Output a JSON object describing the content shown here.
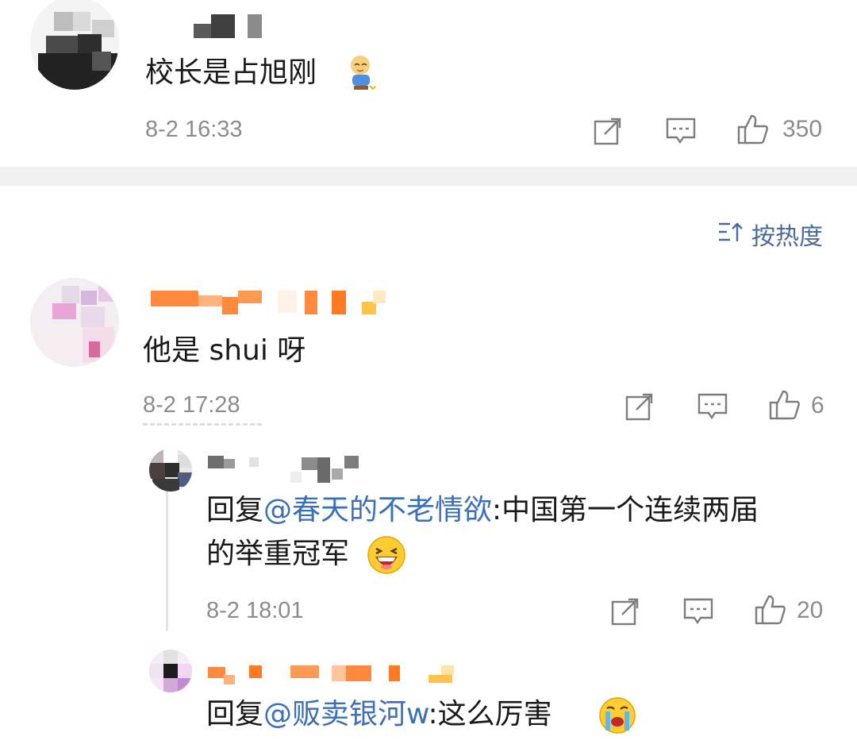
{
  "comments": [
    {
      "text": "校长是占旭刚",
      "time": "8-2 16:33",
      "likes": "350"
    },
    {
      "text": "他是 shui 呀",
      "time": "8-2 17:28",
      "likes": "6",
      "replies": [
        {
          "prefix": "回复",
          "mention": "@春天的不老情欲",
          "text_line1": ":中国第一个连续两届",
          "text_line2": "的举重冠军",
          "time": "8-2 18:01",
          "likes": "20"
        },
        {
          "prefix": "回复",
          "mention": "@贩卖银河w",
          "text_line1": ":这么厉害"
        }
      ]
    }
  ],
  "sort_label": "按热度",
  "colors": {
    "mention": "#3b6fb6",
    "meta": "#8c8c8c",
    "sort": "#4a6a9a"
  },
  "icons": [
    "share-icon",
    "comment-icon",
    "thumbs-up-icon",
    "sort-icon"
  ]
}
